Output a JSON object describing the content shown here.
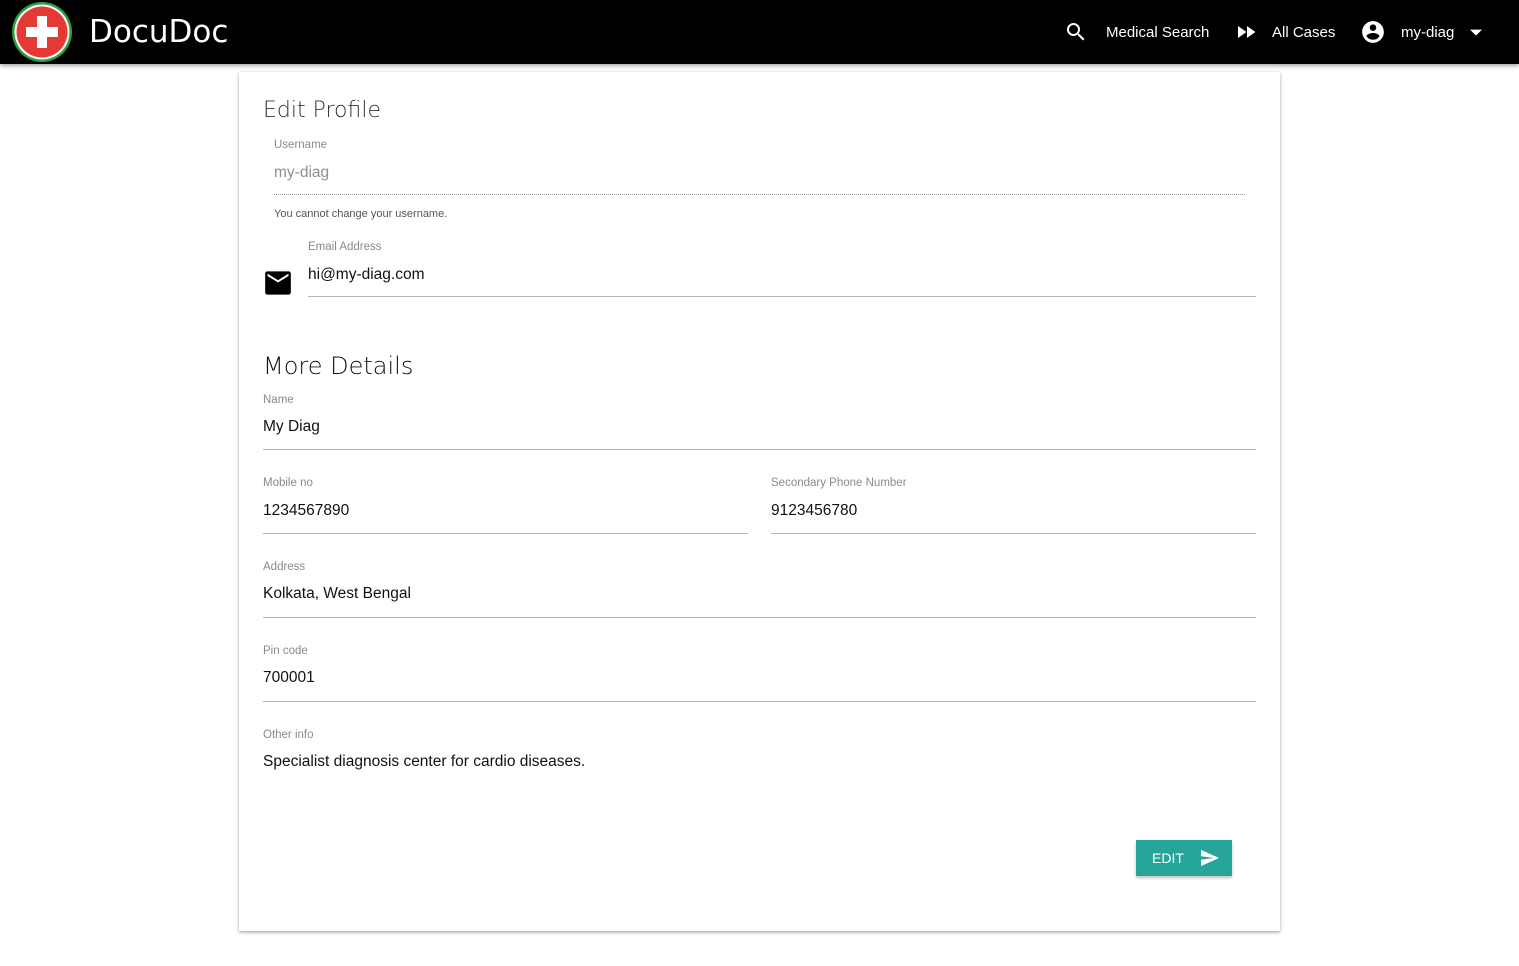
{
  "navbar": {
    "brand": "DocuDoc",
    "logo_icon": "red-cross-icon",
    "search_label": "Medical Search",
    "cases_label": "All Cases",
    "user_label": "my-diag"
  },
  "profile": {
    "title": "Edit Profile",
    "username_label": "Username",
    "username_value": "my-diag",
    "username_helper": "You cannot change your username.",
    "email_label": "Email Address",
    "email_value": "hi@my-diag.com"
  },
  "details": {
    "title": "More Details",
    "name_label": "Name",
    "name_value": "My Diag",
    "mobile_label": "Mobile no",
    "mobile_value": "1234567890",
    "secondary_label": "Secondary Phone Number",
    "secondary_value": "9123456780",
    "address_label": "Address",
    "address_value": "Kolkata, West Bengal",
    "pin_label": "Pin code",
    "pin_value": "700001",
    "other_label": "Other info",
    "other_value": "Specialist diagnosis center for cardio diseases."
  },
  "actions": {
    "edit_label": "EDIT"
  },
  "colors": {
    "navbar": "#000000",
    "logo_red": "#e53935",
    "logo_ring": "#2e9e3e",
    "button": "#26a69a"
  }
}
